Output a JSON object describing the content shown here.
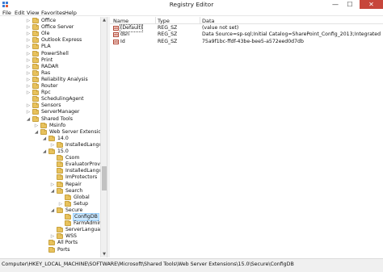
{
  "window": {
    "title": "Registry Editor",
    "min_glyph": "—",
    "max_glyph": "☐",
    "close_glyph": "✕",
    "icon": "registry-icon"
  },
  "menu": [
    "File",
    "Edit",
    "View",
    "Favorites",
    "Help"
  ],
  "tree": [
    {
      "label": "Office",
      "state": "collapsed",
      "depth": 0
    },
    {
      "label": "Office Server",
      "state": "collapsed",
      "depth": 0
    },
    {
      "label": "Ole",
      "state": "collapsed",
      "depth": 0
    },
    {
      "label": "Outlook Express",
      "state": "collapsed",
      "depth": 0
    },
    {
      "label": "PLA",
      "state": "collapsed",
      "depth": 0
    },
    {
      "label": "PowerShell",
      "state": "collapsed",
      "depth": 0
    },
    {
      "label": "Print",
      "state": "collapsed",
      "depth": 0
    },
    {
      "label": "RADAR",
      "state": "collapsed",
      "depth": 0
    },
    {
      "label": "Ras",
      "state": "collapsed",
      "depth": 0
    },
    {
      "label": "Reliability Analysis",
      "state": "collapsed",
      "depth": 0
    },
    {
      "label": "Router",
      "state": "collapsed",
      "depth": 0
    },
    {
      "label": "Rpc",
      "state": "collapsed",
      "depth": 0
    },
    {
      "label": "SchedulingAgent",
      "state": "none",
      "depth": 0
    },
    {
      "label": "Sensors",
      "state": "collapsed",
      "depth": 0
    },
    {
      "label": "ServerManager",
      "state": "collapsed",
      "depth": 0
    },
    {
      "label": "Shared Tools",
      "state": "expanded",
      "depth": 0
    },
    {
      "label": "Msinfo",
      "state": "collapsed",
      "depth": 1
    },
    {
      "label": "Web Server Extensions",
      "state": "expanded",
      "depth": 1
    },
    {
      "label": "14.0",
      "state": "expanded",
      "depth": 2
    },
    {
      "label": "InstalledLanguage",
      "state": "collapsed",
      "depth": 3
    },
    {
      "label": "15.0",
      "state": "expanded",
      "depth": 2
    },
    {
      "label": "Csom",
      "state": "none",
      "depth": 3
    },
    {
      "label": "EvaluatorProvision",
      "state": "none",
      "depth": 3
    },
    {
      "label": "InstalledLanguage",
      "state": "none",
      "depth": 3
    },
    {
      "label": "ImProtectors",
      "state": "none",
      "depth": 3
    },
    {
      "label": "Repair",
      "state": "collapsed",
      "depth": 3
    },
    {
      "label": "Search",
      "state": "expanded",
      "depth": 3
    },
    {
      "label": "Global",
      "state": "none",
      "depth": 4
    },
    {
      "label": "Setup",
      "state": "collapsed",
      "depth": 4
    },
    {
      "label": "Secure",
      "state": "expanded",
      "depth": 3
    },
    {
      "label": "ConfigDB",
      "state": "none",
      "depth": 4,
      "selected": true
    },
    {
      "label": "FarmAdmin",
      "state": "none",
      "depth": 4
    },
    {
      "label": "ServerLanguage",
      "state": "none",
      "depth": 3
    },
    {
      "label": "WSS",
      "state": "collapsed",
      "depth": 3
    },
    {
      "label": "All Ports",
      "state": "none",
      "depth": 2
    },
    {
      "label": "Ports",
      "state": "none",
      "depth": 2
    }
  ],
  "list": {
    "headers": {
      "name": "Name",
      "type": "Type",
      "data": "Data"
    },
    "rows": [
      {
        "name": "(Default)",
        "type": "REG_SZ",
        "data": "(value not set)",
        "icon_text": "ab",
        "focused": true
      },
      {
        "name": "dsn",
        "type": "REG_SZ",
        "data": "Data Source=sp-sql;Initial Catalog=SharePoint_Config_2013;Integrated Security=True;E...",
        "icon_text": "ab",
        "focused": false
      },
      {
        "name": "Id",
        "type": "REG_SZ",
        "data": "75a9f1bc-ffdf-43be-bee5-a572eed0d7db",
        "icon_text": "ab",
        "focused": false
      }
    ]
  },
  "status": {
    "path": "Computer\\HKEY_LOCAL_MACHINE\\SOFTWARE\\Microsoft\\Shared Tools\\Web Server Extensions\\15.0\\Secure\\ConfigDB"
  },
  "colors": {
    "accent": "#c7463b",
    "folder": "#e8c25d",
    "selection": "#cce8ff"
  }
}
